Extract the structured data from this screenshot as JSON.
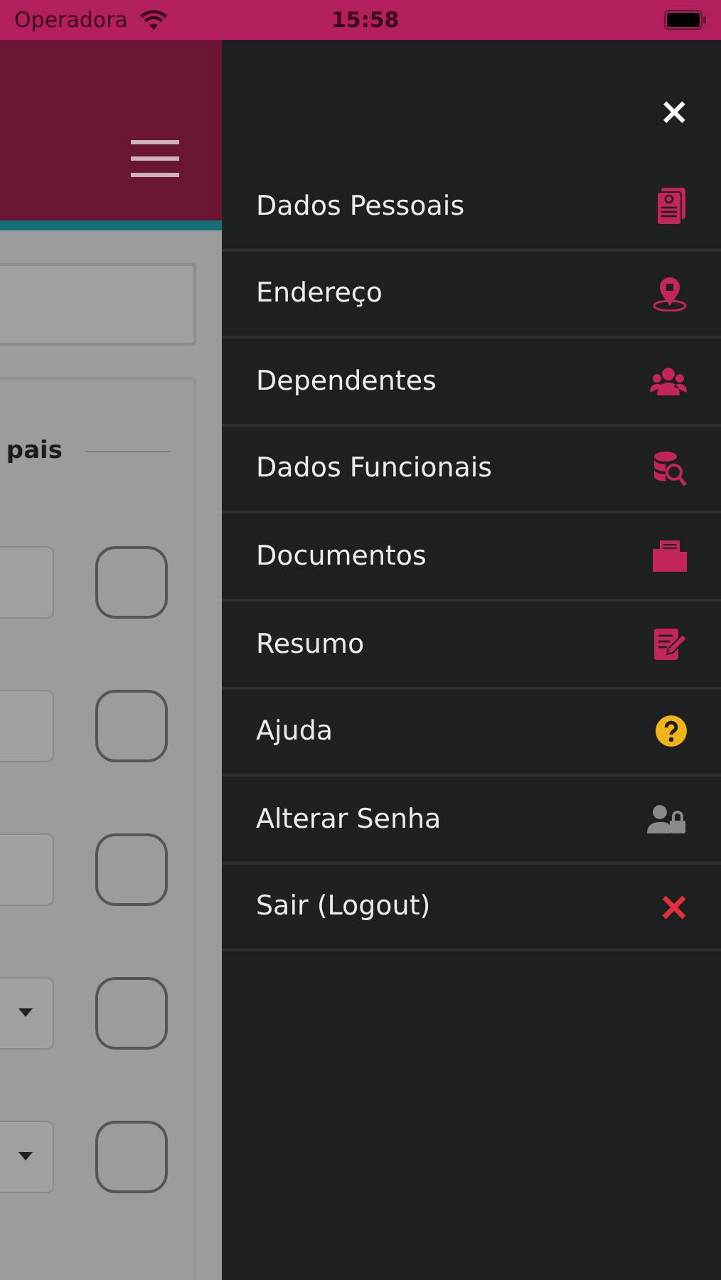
{
  "status_bar": {
    "carrier": "Operadora",
    "time": "15:58"
  },
  "background": {
    "section_title": "pais",
    "rows": [
      {
        "kind": "text"
      },
      {
        "kind": "text"
      },
      {
        "kind": "text"
      },
      {
        "kind": "select"
      },
      {
        "kind": "select"
      }
    ]
  },
  "drawer": {
    "close": "×",
    "items": [
      {
        "label": "Dados Pessoais",
        "color": "#c2255c"
      },
      {
        "label": "Endereço",
        "color": "#c2255c"
      },
      {
        "label": "Dependentes",
        "color": "#c2255c"
      },
      {
        "label": "Dados Funcionais",
        "color": "#c2255c"
      },
      {
        "label": "Documentos",
        "color": "#c2255c"
      },
      {
        "label": "Resumo",
        "color": "#c2255c"
      },
      {
        "label": "Ajuda",
        "color": "#f0b418"
      },
      {
        "label": "Alterar Senha",
        "color": "#8a8a8a"
      },
      {
        "label": "Sair (Logout)",
        "color": "#e0303a"
      }
    ]
  }
}
